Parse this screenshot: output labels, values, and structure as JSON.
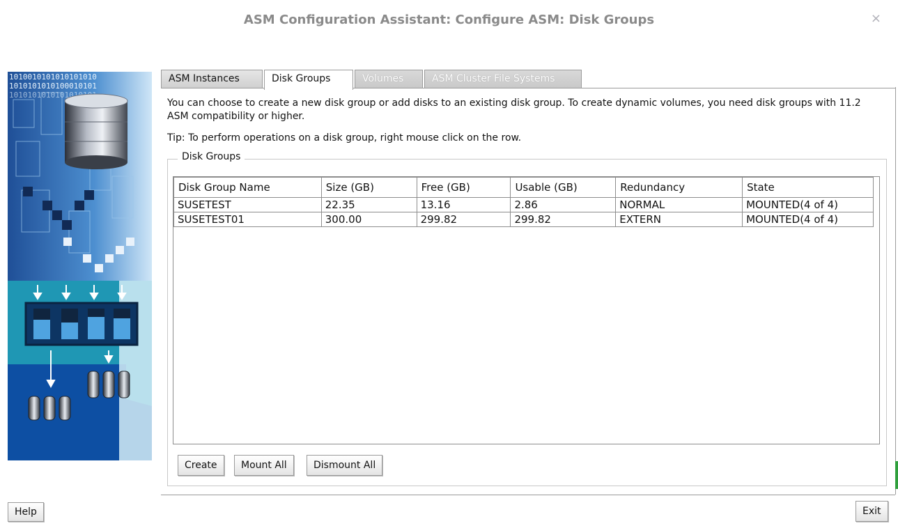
{
  "window": {
    "title": "ASM Configuration Assistant: Configure ASM: Disk Groups",
    "close_glyph": "×"
  },
  "tabs": [
    {
      "label": "ASM Instances",
      "state": "normal"
    },
    {
      "label": "Disk Groups",
      "state": "active"
    },
    {
      "label": "Volumes",
      "state": "disabled"
    },
    {
      "label": "ASM Cluster File Systems",
      "state": "disabled"
    }
  ],
  "description": "You can choose to create a new disk group or add disks to an existing disk group. To create dynamic volumes, you need disk groups with 11.2 ASM compatibility or higher.",
  "tip": "Tip: To perform operations on a disk group, right mouse click on the row.",
  "disk_groups": {
    "legend": "Disk Groups",
    "columns": [
      "Disk Group Name",
      "Size (GB)",
      "Free (GB)",
      "Usable (GB)",
      "Redundancy",
      "State"
    ],
    "rows": [
      [
        "SUSETEST",
        "22.35",
        "13.16",
        "2.86",
        "NORMAL",
        "MOUNTED(4 of 4)"
      ],
      [
        "SUSETEST01",
        "300.00",
        "299.82",
        "299.82",
        "EXTERN",
        "MOUNTED(4 of 4)"
      ]
    ],
    "buttons": {
      "create": "Create",
      "mount_all": "Mount All",
      "dismount_all": "Dismount All"
    }
  },
  "side_art": {
    "binary_line_1": "1010010101010101010",
    "binary_line_2": "1010101010100010101",
    "binary_line_3": "1010101010101010101"
  },
  "footer": {
    "help": "Help",
    "exit": "Exit"
  },
  "colors": {
    "title": "#8a8a8a",
    "art_dark_blue": "#0d4fa3",
    "art_teal": "#1aa3b8"
  }
}
